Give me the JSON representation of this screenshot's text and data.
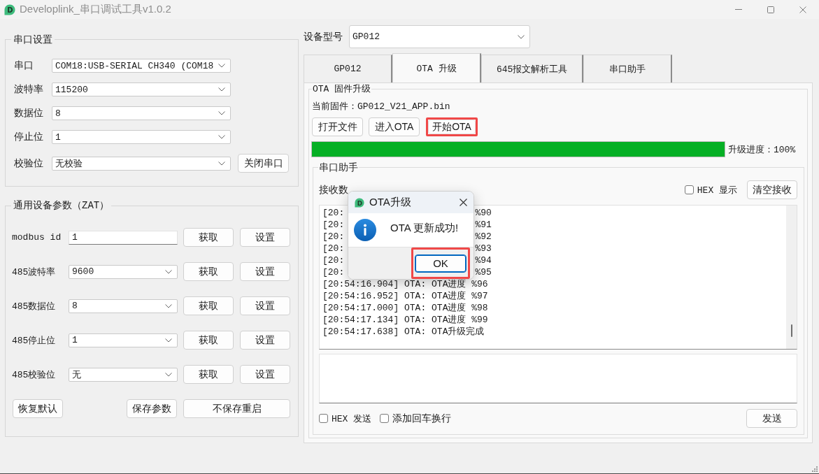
{
  "window": {
    "title": "Developlink_串口调试工具v1.0.2",
    "icon_letter": "D"
  },
  "serial_settings": {
    "title": "串口设置",
    "fields": [
      {
        "label": "串口",
        "value": "COM18:USB-SERIAL CH340 (COM18"
      },
      {
        "label": "波特率",
        "value": "115200"
      },
      {
        "label": "数据位",
        "value": "8"
      },
      {
        "label": "停止位",
        "value": "1"
      },
      {
        "label": "校验位",
        "value": "无校验"
      }
    ],
    "port_button": "关闭串口"
  },
  "device_params": {
    "title": "通用设备参数（ZAT）",
    "rows": [
      {
        "label": "modbus id",
        "kind": "input",
        "value": "1",
        "get_button": "获取",
        "set_button": "设置"
      },
      {
        "label": "485波特率",
        "kind": "select",
        "value": "9600",
        "get_button": "获取",
        "set_button": "设置"
      },
      {
        "label": "485数据位",
        "kind": "select",
        "value": "8",
        "get_button": "获取",
        "set_button": "设置"
      },
      {
        "label": "485停止位",
        "kind": "select",
        "value": "1",
        "get_button": "获取",
        "set_button": "设置"
      },
      {
        "label": "485校验位",
        "kind": "select",
        "value": "无",
        "get_button": "获取",
        "set_button": "设置"
      }
    ],
    "buttons": [
      "恢复默认",
      "保存参数",
      "不保存重启"
    ]
  },
  "device_model": {
    "label": "设备型号",
    "value": "GP012"
  },
  "tabs": [
    {
      "label": "GP012",
      "selected": false
    },
    {
      "label": "OTA 升级",
      "selected": true
    },
    {
      "label": "645报文解析工具",
      "selected": false
    },
    {
      "label": "串口助手",
      "selected": false
    }
  ],
  "ota": {
    "title": "OTA 固件升级",
    "current_firmware": "当前固件：GP012_V21_APP.bin",
    "buttons": [
      {
        "label": "打开文件",
        "highlighted": false
      },
      {
        "label": "进入OTA",
        "highlighted": false
      },
      {
        "label": "开始OTA",
        "highlighted": true
      }
    ],
    "progress": {
      "level": 1,
      "label": "升级进度：100%"
    }
  },
  "serial_assistant": {
    "title": "串口助手",
    "receive_label": "接收数",
    "hex_display": {
      "label": "HEX 显示",
      "checked": false
    },
    "clear_button": "清空接收",
    "log": [
      {
        "kind": "covered",
        "start": "[20:",
        "end": "%90"
      },
      {
        "kind": "covered",
        "start": "[20:",
        "end": "%91"
      },
      {
        "kind": "covered",
        "start": "[20:",
        "end": "%92"
      },
      {
        "kind": "covered",
        "start": "[20:",
        "end": "%93"
      },
      {
        "kind": "covered",
        "start": "[20:",
        "end": "%94"
      },
      {
        "kind": "covered",
        "start": "[20:",
        "end": "%95"
      },
      {
        "kind": "line",
        "text": "[20:54:16.904] OTA: OTA进度 %96"
      },
      {
        "kind": "line",
        "text": "[20:54:16.952] OTA: OTA进度 %97"
      },
      {
        "kind": "line",
        "text": "[20:54:17.000] OTA: OTA进度 %98"
      },
      {
        "kind": "line",
        "text": "[20:54:17.134] OTA: OTA进度 %99"
      },
      {
        "kind": "line",
        "text": "[20:54:17.638] OTA: OTA升级完成"
      }
    ],
    "hex_send": {
      "label": "HEX 发送",
      "checked": false
    },
    "add_newline": {
      "label": "添加回车换行",
      "checked": false
    },
    "send_button": "发送"
  },
  "dialog": {
    "icon_letter": "D",
    "title": "OTA升级",
    "message": "OTA 更新成功!",
    "ok_button": {
      "label": "OK",
      "highlighted": true
    }
  }
}
